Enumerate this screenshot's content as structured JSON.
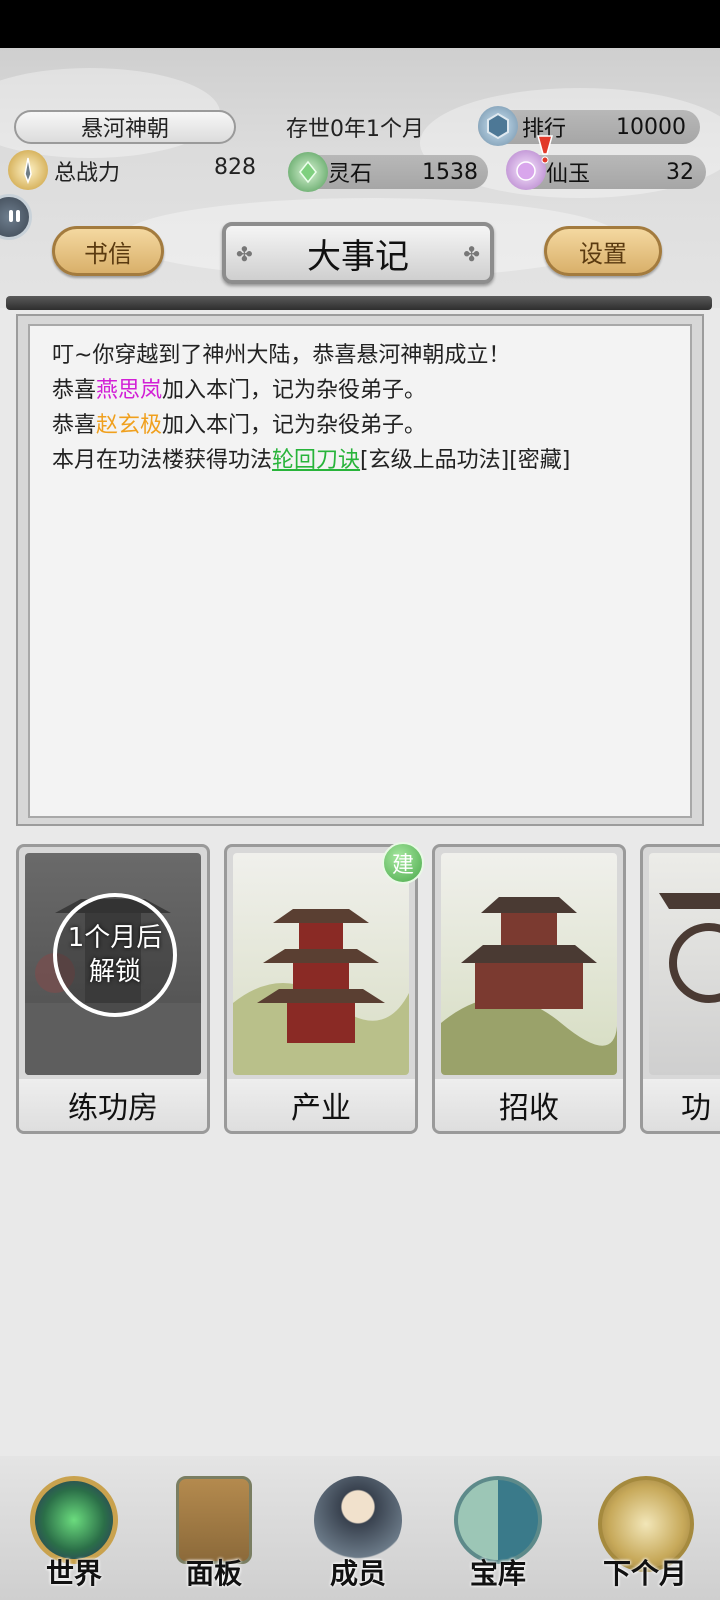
{
  "header": {
    "sect_name": "悬河神朝",
    "age": "存世0年1个月",
    "rank_label": "排行",
    "rank_value": "10000",
    "power_label": "总战力",
    "power_value": "828",
    "spirit_stone_label": "灵石",
    "spirit_stone_value": "1538",
    "jade_label": "仙玉",
    "jade_value": "32"
  },
  "toolbar": {
    "letters_label": "书信",
    "title": "大事记",
    "settings_label": "设置"
  },
  "log": {
    "line1": "叮~你穿越到了神州大陆，恭喜悬河神朝成立！",
    "line2_prefix": "恭喜",
    "line2_name": "燕思岚",
    "line2_suffix": "加入本门，记为杂役弟子。",
    "line3_prefix": "恭喜",
    "line3_name": "赵玄极",
    "line3_suffix": "加入本门，记为杂役弟子。",
    "line4_prefix": "本月在功法楼获得功法",
    "line4_skill": "轮回刀诀",
    "line4_suffix": "[玄级上品功法][密藏]"
  },
  "cards": {
    "training_room": "练功房",
    "training_lock_line1": "1个月后",
    "training_lock_line2": "解锁",
    "industry": "产业",
    "industry_badge": "建",
    "recruit": "招收",
    "partial": "功"
  },
  "nav": {
    "world": "世界",
    "panel": "面板",
    "members": "成员",
    "treasury": "宝库",
    "next_month": "下个月"
  },
  "colors": {
    "member_pink": "#d21fd6",
    "member_orange": "#f0a01e",
    "skill_green": "#28b43a",
    "gold_button": "#d9b06a"
  }
}
